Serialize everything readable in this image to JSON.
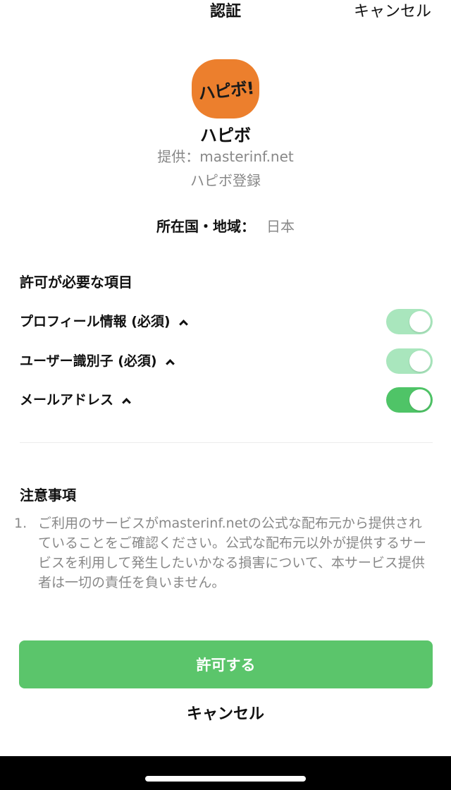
{
  "header": {
    "title": "認証",
    "cancel_label": "キャンセル"
  },
  "app": {
    "logo_text": "ハピボ!",
    "logo_color": "#ec7f2d",
    "name": "ハピボ",
    "provider": "提供：masterinf.net",
    "purpose": "ハピボ登録"
  },
  "region": {
    "label": "所在国・地域：",
    "value": "日本"
  },
  "permissions": {
    "heading": "許可が必要な項目",
    "items": [
      {
        "label": "プロフィール情報 (必須)",
        "enabled": true,
        "required": true
      },
      {
        "label": "ユーザー識別子 (必須)",
        "enabled": true,
        "required": true
      },
      {
        "label": "メールアドレス",
        "enabled": true,
        "required": false
      }
    ]
  },
  "notes": {
    "heading": "注意事項",
    "items": [
      {
        "number": "1.",
        "text": "ご利用のサービスがmasterinf.netの公式な配布元から提供されていることをご確認ください。公式な配布元以外が提供するサービスを利用して発生したいかなる損害について、本サービス提供者は一切の責任を負いません。"
      }
    ]
  },
  "actions": {
    "allow_label": "許可する",
    "cancel_label": "キャンセル"
  },
  "colors": {
    "accent": "#5bc56b",
    "toggle_on": "#4fc467",
    "toggle_on_disabled": "#a9e6bd",
    "muted_text": "#888888"
  }
}
